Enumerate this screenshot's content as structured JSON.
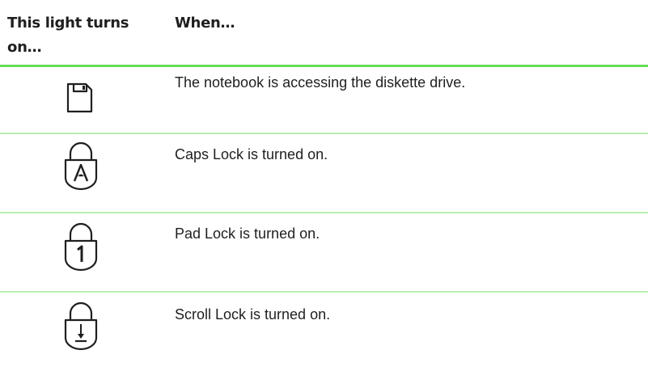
{
  "table": {
    "header": {
      "col1": "This light turns on…",
      "col2": "When…"
    },
    "rows": [
      {
        "icon": "diskette-drive-icon",
        "description": "The notebook is accessing the diskette drive."
      },
      {
        "icon": "caps-lock-icon",
        "description": "Caps Lock is turned on."
      },
      {
        "icon": "pad-lock-icon",
        "description": "Pad Lock is turned on."
      },
      {
        "icon": "scroll-lock-icon",
        "description": "Scroll Lock is turned on."
      }
    ]
  },
  "colors": {
    "header_rule": "#66dd55",
    "row_divider": "#b7efb0",
    "text": "#1f1f1f"
  }
}
